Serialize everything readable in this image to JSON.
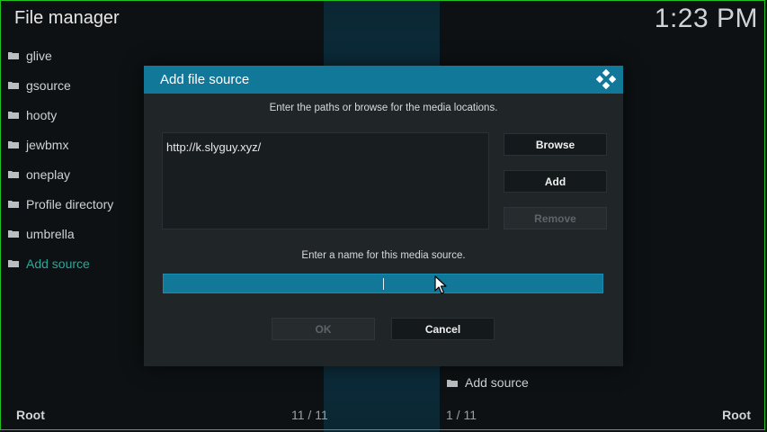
{
  "app": {
    "title": "File manager",
    "clock": "1:23 PM"
  },
  "left_list": {
    "items": [
      {
        "label": "glive"
      },
      {
        "label": "gsource"
      },
      {
        "label": "hooty"
      },
      {
        "label": "jewbmx"
      },
      {
        "label": "oneplay"
      },
      {
        "label": "Profile directory"
      },
      {
        "label": "umbrella"
      },
      {
        "label": "Add source",
        "accent": true
      }
    ]
  },
  "right_list": {
    "item_label": "Add source"
  },
  "footer": {
    "left": "Root",
    "left_count": "11 / 11",
    "right_count": "1 / 11",
    "right": "Root"
  },
  "dialog": {
    "title": "Add file source",
    "instruction": "Enter the paths or browse for the media locations.",
    "path_value": "http://k.slyguy.xyz/",
    "browse_label": "Browse",
    "add_label": "Add",
    "remove_label": "Remove",
    "name_instruction": "Enter a name for this media source.",
    "name_value": "",
    "ok_label": "OK",
    "cancel_label": "Cancel"
  },
  "colors": {
    "accent_blue": "#12789a",
    "accent_teal": "#2aa79a",
    "dialog_bg": "#202628",
    "frame_green": "#1fc21f"
  },
  "icons": {
    "folder": "folder-icon",
    "logo": "kodi-logo-icon",
    "pointer": "mouse-pointer-icon"
  }
}
